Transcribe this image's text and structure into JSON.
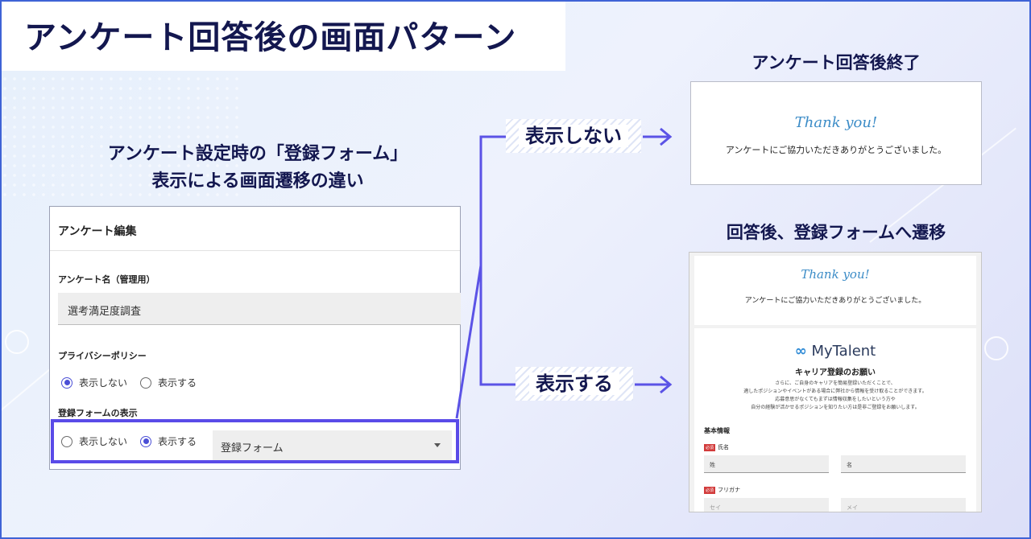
{
  "title": "アンケート回答後の画面パターン",
  "center_caption": {
    "line1": "アンケート設定時の「登録フォーム」",
    "line2": "表示による画面遷移の違い"
  },
  "panel": {
    "header": "アンケート編集",
    "name_label": "アンケート名（管理用）",
    "name_value": "選考満足度調査",
    "privacy_label": "プライバシーポリシー",
    "privacy_options": [
      {
        "label": "表示しない",
        "selected": true
      },
      {
        "label": "表示する",
        "selected": false
      }
    ],
    "form_label": "登録フォームの表示",
    "form_options": [
      {
        "label": "表示しない",
        "selected": false
      },
      {
        "label": "表示する",
        "selected": true
      }
    ],
    "form_select_value": "登録フォーム"
  },
  "branches": {
    "hide_tag": "表示しない",
    "show_tag": "表示する"
  },
  "result_hide": {
    "caption": "アンケート回答後終了",
    "thank": "Thank you!",
    "message": "アンケートにご協力いただきありがとうございました。"
  },
  "result_show": {
    "caption": "回答後、登録フォームへ遷移",
    "thank": "Thank you!",
    "message": "アンケートにご協力いただきありがとうございました。",
    "brand": "MyTalent",
    "form_title": "キャリア登録のお願い",
    "intro": [
      "さらに、ご自身のキャリアを簡易登録いただくことで、",
      "適したポジションやイベントがある場合に弊社から情報を受け取ることができます。",
      "応募意思がなくてもまずは情報収集をしたいという方や",
      "自分の経験が活かせるポジションを知りたい方は是非ご登録をお願いします。"
    ],
    "section": "基本情報",
    "required_badge": "必須",
    "name_label": "氏名",
    "last_name": "姓",
    "first_name": "名",
    "kana_label": "フリガナ",
    "last_kana_placeholder": "セイ",
    "first_kana_placeholder": "メイ"
  },
  "colors": {
    "accent": "#5a4be8",
    "navy": "#13174f",
    "thank": "#3c8cc7",
    "required": "#d23b3b"
  }
}
